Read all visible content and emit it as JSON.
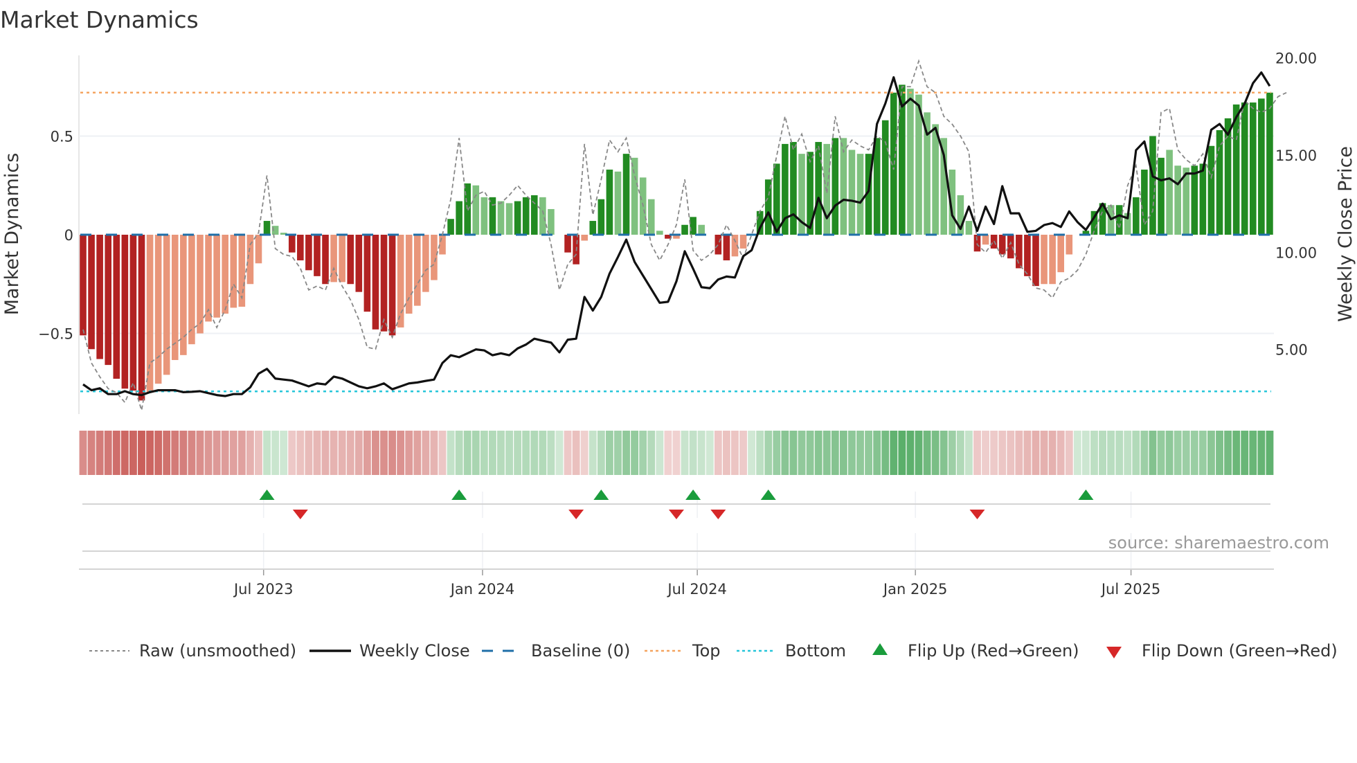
{
  "title": "Market Dynamics",
  "source": "source: sharemaestro.com",
  "colors": {
    "neg_strong": "#b22222",
    "neg_weak": "#e9967a",
    "pos_strong": "#228b22",
    "pos_weak": "#7fc17f",
    "raw": "#888888",
    "close": "#111111",
    "baseline": "#1f6fa8",
    "top": "#f4a460",
    "bottom": "#26c6da",
    "flip_up": "#1a9c3c",
    "flip_down": "#d62728"
  },
  "chart_data": {
    "type": "bar",
    "title": "Market Dynamics",
    "ylabel": "Market Dynamics",
    "y2label": "Weekly Close Price",
    "ylim": [
      -0.9,
      0.92
    ],
    "y2lim": [
      1.7,
      20.1
    ],
    "yticks": [
      {
        "v": 0.5,
        "label": "0.5"
      },
      {
        "v": 0,
        "label": "0"
      },
      {
        "v": -0.5,
        "label": "−0.5"
      }
    ],
    "y2ticks": [
      {
        "v": 20,
        "label": "20.00"
      },
      {
        "v": 15,
        "label": "15.00"
      },
      {
        "v": 10,
        "label": "10.00"
      },
      {
        "v": 5,
        "label": "5.00"
      }
    ],
    "xticks": [
      {
        "i": 21.6,
        "label": "Jul 2023"
      },
      {
        "i": 47.8,
        "label": "Jan 2024"
      },
      {
        "i": 73.5,
        "label": "Jul 2024"
      },
      {
        "i": 99.6,
        "label": "Jan 2025"
      },
      {
        "i": 125.4,
        "label": "Jul 2025"
      }
    ],
    "top_level": 0.72,
    "bottom_level": -0.794,
    "baseline": 0,
    "bars": [
      -0.51,
      -0.58,
      -0.63,
      -0.66,
      -0.73,
      -0.78,
      -0.79,
      -0.84,
      -0.8,
      -0.755,
      -0.71,
      -0.635,
      -0.61,
      -0.555,
      -0.5,
      -0.44,
      -0.42,
      -0.4,
      -0.37,
      -0.365,
      -0.25,
      -0.145,
      0.07,
      0.045,
      0.01,
      -0.09,
      -0.13,
      -0.18,
      -0.21,
      -0.25,
      -0.24,
      -0.24,
      -0.25,
      -0.29,
      -0.39,
      -0.48,
      -0.49,
      -0.51,
      -0.47,
      -0.4,
      -0.36,
      -0.29,
      -0.23,
      -0.1,
      0.08,
      0.17,
      0.26,
      0.25,
      0.19,
      0.19,
      0.17,
      0.16,
      0.17,
      0.19,
      0.2,
      0.19,
      0.13,
      0,
      -0.09,
      -0.15,
      -0.03,
      0.07,
      0.18,
      0.33,
      0.32,
      0.41,
      0.39,
      0.29,
      0.18,
      0.02,
      -0.02,
      -0.02,
      0.05,
      0.09,
      0.05,
      0,
      -0.1,
      -0.13,
      -0.11,
      -0.07,
      0,
      0.12,
      0.28,
      0.36,
      0.46,
      0.47,
      0.41,
      0.42,
      0.47,
      0.46,
      0.49,
      0.49,
      0.43,
      0.41,
      0.41,
      0.49,
      0.58,
      0.72,
      0.76,
      0.74,
      0.71,
      0.62,
      0.56,
      0.49,
      0.33,
      0.2,
      0.07,
      -0.085,
      -0.05,
      -0.07,
      -0.1,
      -0.12,
      -0.17,
      -0.21,
      -0.26,
      -0.25,
      -0.25,
      -0.19,
      -0.1,
      0,
      0.02,
      0.12,
      0.16,
      0.15,
      0.15,
      0.11,
      0.19,
      0.33,
      0.5,
      0.39,
      0.43,
      0.35,
      0.34,
      0.35,
      0.36,
      0.45,
      0.53,
      0.59,
      0.66,
      0.67,
      0.67,
      0.69,
      0.72
    ],
    "strong": [
      1,
      1,
      1,
      1,
      1,
      1,
      1,
      1,
      0,
      0,
      0,
      0,
      0,
      0,
      0,
      0,
      0,
      0,
      0,
      0,
      0,
      0,
      1,
      0,
      0,
      1,
      1,
      1,
      1,
      1,
      0,
      0,
      1,
      1,
      1,
      1,
      1,
      1,
      0,
      0,
      0,
      0,
      0,
      0,
      1,
      1,
      1,
      0,
      0,
      1,
      0,
      0,
      1,
      1,
      1,
      0,
      0,
      0,
      1,
      1,
      0,
      1,
      1,
      1,
      0,
      1,
      0,
      0,
      0,
      0,
      1,
      0,
      1,
      1,
      0,
      0,
      1,
      1,
      0,
      0,
      0,
      1,
      1,
      1,
      1,
      1,
      0,
      1,
      1,
      0,
      1,
      0,
      0,
      0,
      1,
      1,
      1,
      1,
      1,
      0,
      0,
      0,
      0,
      0,
      0,
      0,
      0,
      1,
      0,
      1,
      1,
      1,
      1,
      1,
      1,
      0,
      0,
      0,
      0,
      0,
      1,
      1,
      1,
      0,
      1,
      0,
      1,
      1,
      1,
      1,
      0,
      0,
      0,
      1,
      1,
      1,
      1,
      1,
      1,
      1,
      1,
      1,
      1
    ],
    "raw": [
      -0.48,
      -0.65,
      -0.72,
      -0.78,
      -0.8,
      -0.85,
      -0.75,
      -0.89,
      -0.65,
      -0.62,
      -0.58,
      -0.55,
      -0.52,
      -0.48,
      -0.45,
      -0.38,
      -0.47,
      -0.38,
      -0.25,
      -0.32,
      -0.05,
      0.01,
      0.3,
      -0.07,
      -0.1,
      -0.11,
      -0.17,
      -0.28,
      -0.26,
      -0.28,
      -0.17,
      -0.26,
      -0.33,
      -0.43,
      -0.57,
      -0.58,
      -0.43,
      -0.52,
      -0.4,
      -0.32,
      -0.25,
      -0.18,
      -0.15,
      0.0,
      0.18,
      0.49,
      0.12,
      0.2,
      0.22,
      0.15,
      0.16,
      0.2,
      0.25,
      0.2,
      0.16,
      0.12,
      -0.05,
      -0.28,
      -0.15,
      -0.1,
      0.46,
      0.1,
      0.28,
      0.48,
      0.42,
      0.49,
      0.3,
      0.15,
      -0.05,
      -0.13,
      -0.05,
      0.05,
      0.28,
      -0.08,
      -0.13,
      -0.1,
      -0.05,
      0.05,
      -0.03,
      -0.12,
      0.0,
      0.12,
      0.19,
      0.4,
      0.6,
      0.43,
      0.51,
      0.37,
      0.45,
      0.21,
      0.6,
      0.42,
      0.48,
      0.45,
      0.43,
      0.5,
      0.47,
      0.33,
      0.75,
      0.75,
      0.88,
      0.75,
      0.72,
      0.6,
      0.56,
      0.5,
      0.42,
      -0.05,
      -0.09,
      -0.03,
      -0.12,
      -0.04,
      -0.15,
      -0.2,
      -0.27,
      -0.28,
      -0.32,
      -0.24,
      -0.22,
      -0.18,
      -0.1,
      0.02,
      0.12,
      0.15,
      0.03,
      0.25,
      0.35,
      0.05,
      0.12,
      0.62,
      0.64,
      0.43,
      0.38,
      0.35,
      0.41,
      0.29,
      0.45,
      0.5,
      0.48,
      0.68,
      0.64,
      0.62,
      0.64,
      0.7,
      0.72
    ],
    "close": [
      3.2,
      2.9,
      3.0,
      2.7,
      2.7,
      2.85,
      2.7,
      2.65,
      2.8,
      2.9,
      2.9,
      2.9,
      2.8,
      2.82,
      2.85,
      2.75,
      2.65,
      2.6,
      2.7,
      2.7,
      3.05,
      3.75,
      4.0,
      3.5,
      3.45,
      3.4,
      3.25,
      3.1,
      3.25,
      3.2,
      3.6,
      3.5,
      3.3,
      3.1,
      3.0,
      3.1,
      3.25,
      2.95,
      3.1,
      3.25,
      3.3,
      3.38,
      3.45,
      4.3,
      4.7,
      4.6,
      4.8,
      5.0,
      4.95,
      4.7,
      4.8,
      4.7,
      5.05,
      5.25,
      5.55,
      5.45,
      5.35,
      4.85,
      5.5,
      5.55,
      7.7,
      7.0,
      7.7,
      8.9,
      9.75,
      10.65,
      9.5,
      8.8,
      8.1,
      7.4,
      7.45,
      8.5,
      10.05,
      9.15,
      8.2,
      8.15,
      8.6,
      8.75,
      8.7,
      9.8,
      10.1,
      11.25,
      12.05,
      11.05,
      11.75,
      11.95,
      11.55,
      11.25,
      12.8,
      11.75,
      12.4,
      12.7,
      12.65,
      12.55,
      13.15,
      16.6,
      17.65,
      19.0,
      17.5,
      17.9,
      17.55,
      16.05,
      16.4,
      15.0,
      11.9,
      11.2,
      12.35,
      11.1,
      12.35,
      11.45,
      13.4,
      12.0,
      12.0,
      11.05,
      11.1,
      11.4,
      11.5,
      11.3,
      12.1,
      11.55,
      11.15,
      11.8,
      12.5,
      11.7,
      11.9,
      11.75,
      15.25,
      15.7,
      13.9,
      13.7,
      13.8,
      13.5,
      14.05,
      14.05,
      14.2,
      16.3,
      16.6,
      16.05,
      16.95,
      17.65,
      18.7,
      19.25,
      18.55
    ],
    "flip_up": [
      22,
      45,
      62,
      73,
      82,
      120
    ],
    "flip_down": [
      26,
      59,
      71,
      76,
      107
    ],
    "legend": {
      "position": "bottom",
      "items": [
        "Raw (unsmoothed)",
        "Weekly Close",
        "Baseline (0)",
        "Top",
        "Bottom",
        "Flip Up (Red→Green)",
        "Flip Down (Green→Red)"
      ]
    }
  }
}
